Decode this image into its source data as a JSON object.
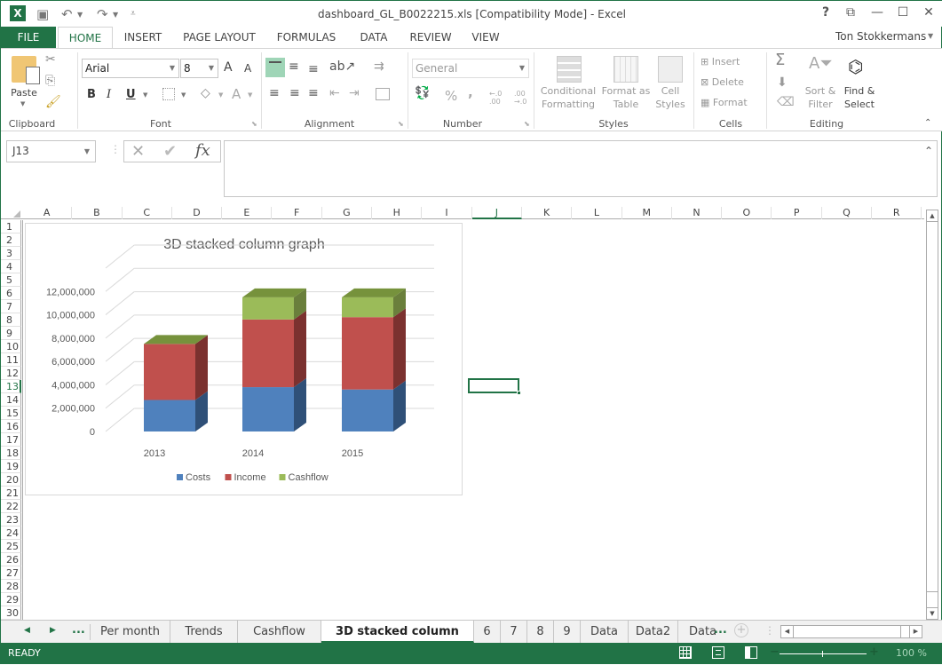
{
  "window": {
    "title": "dashboard_GL_B0022215.xls  [Compatibility Mode] - Excel",
    "user": "Ton  Stokkermans",
    "help": "?",
    "controls": {
      "ribbon_display": "⧉",
      "minimize": "—",
      "maximize": "☐",
      "close": "✕"
    }
  },
  "quick_access": {
    "app_icon": "X",
    "save": "💾",
    "undo": "↶",
    "redo": "↷",
    "customize": "⩡"
  },
  "tabs": [
    "FILE",
    "HOME",
    "INSERT",
    "PAGE LAYOUT",
    "FORMULAS",
    "DATA",
    "REVIEW",
    "VIEW"
  ],
  "ribbon": {
    "clipboard": {
      "label": "Clipboard",
      "paste": "Paste"
    },
    "font": {
      "label": "Font",
      "font_name": "Arial",
      "font_size": "8",
      "bold": "B",
      "italic": "I",
      "underline": "U",
      "grow": "A",
      "shrink": "A",
      "font_color": "A"
    },
    "alignment": {
      "label": "Alignment"
    },
    "number": {
      "label": "Number",
      "format": "General",
      "percent": "%",
      "comma": ",",
      "inc_decimal": "←.0 .00",
      "dec_decimal": ".00 →.0"
    },
    "styles": {
      "label": "Styles",
      "conditional_1": "Conditional",
      "conditional_2": "Formatting",
      "format_table_1": "Format as",
      "format_table_2": "Table",
      "cell_styles_1": "Cell",
      "cell_styles_2": "Styles"
    },
    "cells": {
      "label": "Cells",
      "insert": "Insert",
      "delete": "Delete",
      "format": "Format"
    },
    "editing": {
      "label": "Editing",
      "sum": "Σ",
      "sort_1": "Sort &",
      "sort_2": "Filter",
      "find_1": "Find &",
      "find_2": "Select"
    }
  },
  "formula_bar": {
    "name_box": "J13",
    "cancel": "✕",
    "enter": "✔",
    "fx": "fx",
    "formula": ""
  },
  "columns": [
    "A",
    "B",
    "C",
    "D",
    "E",
    "F",
    "G",
    "H",
    "I",
    "J",
    "K",
    "L",
    "M",
    "N",
    "O",
    "P",
    "Q",
    "R"
  ],
  "rows": [
    "1",
    "2",
    "3",
    "4",
    "5",
    "6",
    "7",
    "8",
    "9",
    "10",
    "11",
    "12",
    "13",
    "14",
    "15",
    "16",
    "17",
    "18",
    "19",
    "20",
    "21",
    "22",
    "23",
    "24",
    "25",
    "26",
    "27",
    "28",
    "29",
    "30"
  ],
  "selected_cell": "J13",
  "sheet_tabs": {
    "nav_prev": "◀",
    "nav_next": "▶",
    "more_left": "...",
    "tabs": [
      "Per month",
      "Trends",
      "Cashflow",
      "3D stacked column graph",
      "6",
      "7",
      "8",
      "9",
      "Data",
      "Data2",
      "Data"
    ],
    "active": "3D stacked column graph",
    "more_right": "...",
    "add": "+"
  },
  "status": {
    "mode": "READY",
    "zoom": "100 %",
    "zoom_minus": "−",
    "zoom_plus": "+"
  },
  "colors": {
    "accent": "#217346",
    "costs": "#4f81bd",
    "income": "#c0504d",
    "cashflow": "#9bbb59"
  },
  "chart_data": {
    "type": "bar",
    "subtype": "3d-stacked-column",
    "title": "3D stacked column graph",
    "categories": [
      "2013",
      "2014",
      "2015"
    ],
    "series": [
      {
        "name": "Costs",
        "values": [
          2700000,
          3800000,
          3600000
        ]
      },
      {
        "name": "Income",
        "values": [
          4800000,
          5800000,
          6200000
        ]
      },
      {
        "name": "Cashflow",
        "values": [
          0,
          1900000,
          1700000
        ]
      }
    ],
    "yticks": [
      "0",
      "2,000,000",
      "4,000,000",
      "6,000,000",
      "8,000,000",
      "10,000,000",
      "12,000,000"
    ],
    "ylim": [
      0,
      14000000
    ],
    "grid": true,
    "legend": "bottom",
    "xlabel": "",
    "ylabel": ""
  }
}
